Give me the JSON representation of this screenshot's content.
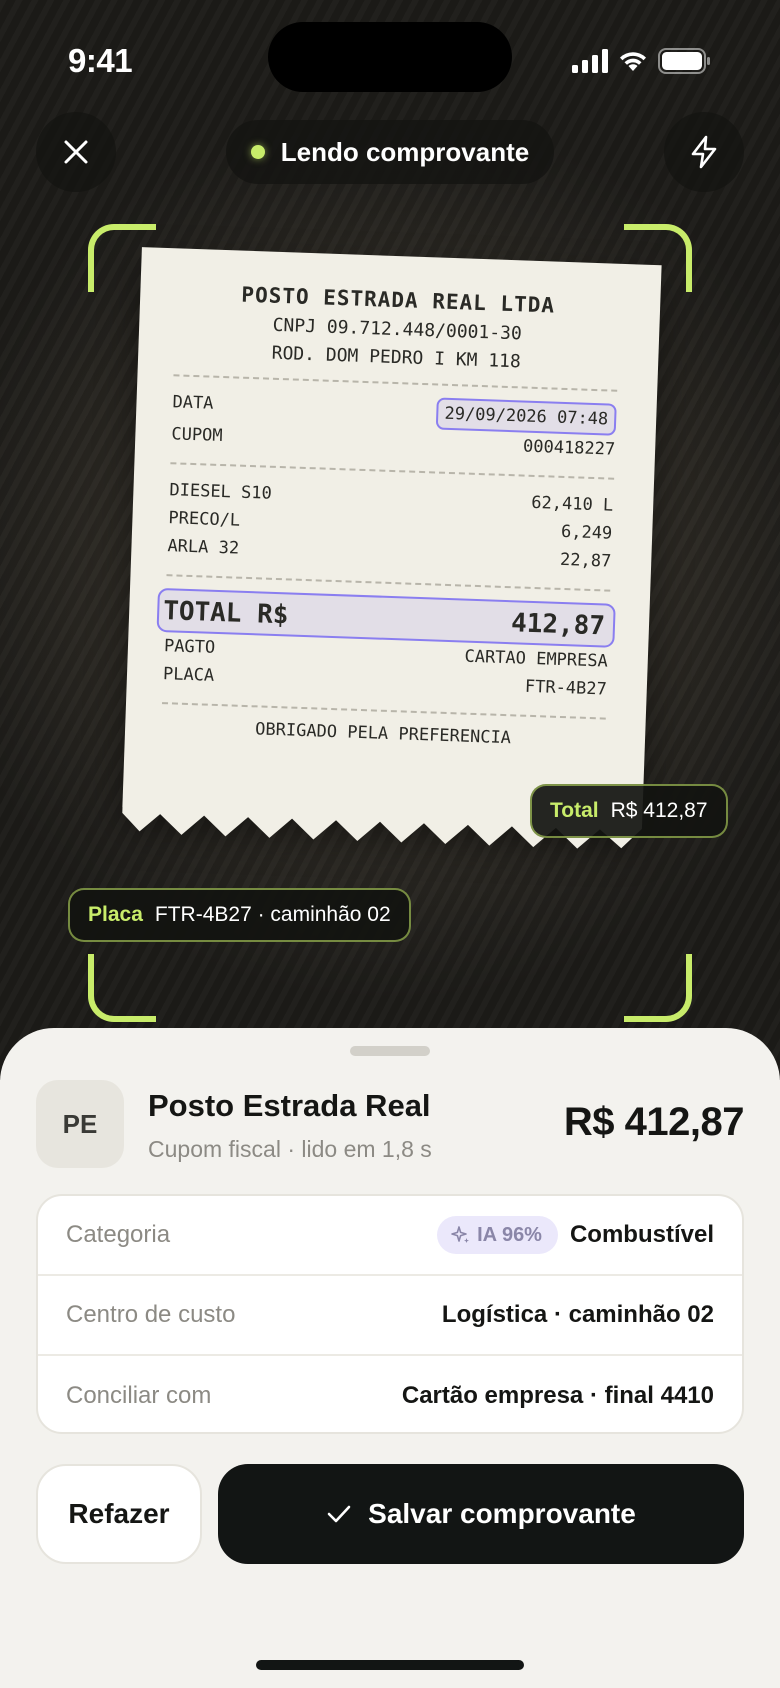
{
  "status_bar": {
    "time": "9:41"
  },
  "scanner": {
    "status_label": "Lendo comprovante",
    "accent_color": "#c8ec6a",
    "close_icon": "close-icon",
    "flash_icon": "flash-icon"
  },
  "receipt": {
    "merchant": "POSTO ESTRADA REAL LTDA",
    "cnpj": "CNPJ 09.712.448/0001-30",
    "address": "ROD. DOM PEDRO I KM 118",
    "date_label": "DATA",
    "date_value": "29/09/2026 07:48",
    "coupon_label": "CUPOM",
    "coupon_value": "000418227",
    "fuel_label": "DIESEL S10",
    "fuel_value": "62,410 L",
    "price_label": "PRECO/L",
    "price_value": "6,249",
    "arla_label": "ARLA 32",
    "arla_value": "22,87",
    "total_label": "TOTAL R$",
    "total_value": "412,87",
    "payment_label": "PAGTO",
    "payment_value": "CARTAO EMPRESA",
    "plate_label": "PLACA",
    "plate_value": "FTR-4B27",
    "thanks": "OBRIGADO PELA PREFERENCIA"
  },
  "tags": {
    "total_key": "Total",
    "total_value": "R$ 412,87",
    "plate_key": "Placa",
    "plate_value": "FTR-4B27 · caminhão 02"
  },
  "sheet": {
    "avatar": "PE",
    "merchant_name": "Posto Estrada Real",
    "merchant_sub": "Cupom fiscal · lido em 1,8 s",
    "amount": "R$ 412,87",
    "rows": [
      {
        "label": "Categoria",
        "badge": "IA 96%",
        "value": "Combustível"
      },
      {
        "label": "Centro de custo",
        "value": "Logística · caminhão 02"
      },
      {
        "label": "Conciliar com",
        "value": "Cartão empresa · final 4410"
      }
    ],
    "redo_label": "Refazer",
    "save_label": "Salvar comprovante"
  }
}
